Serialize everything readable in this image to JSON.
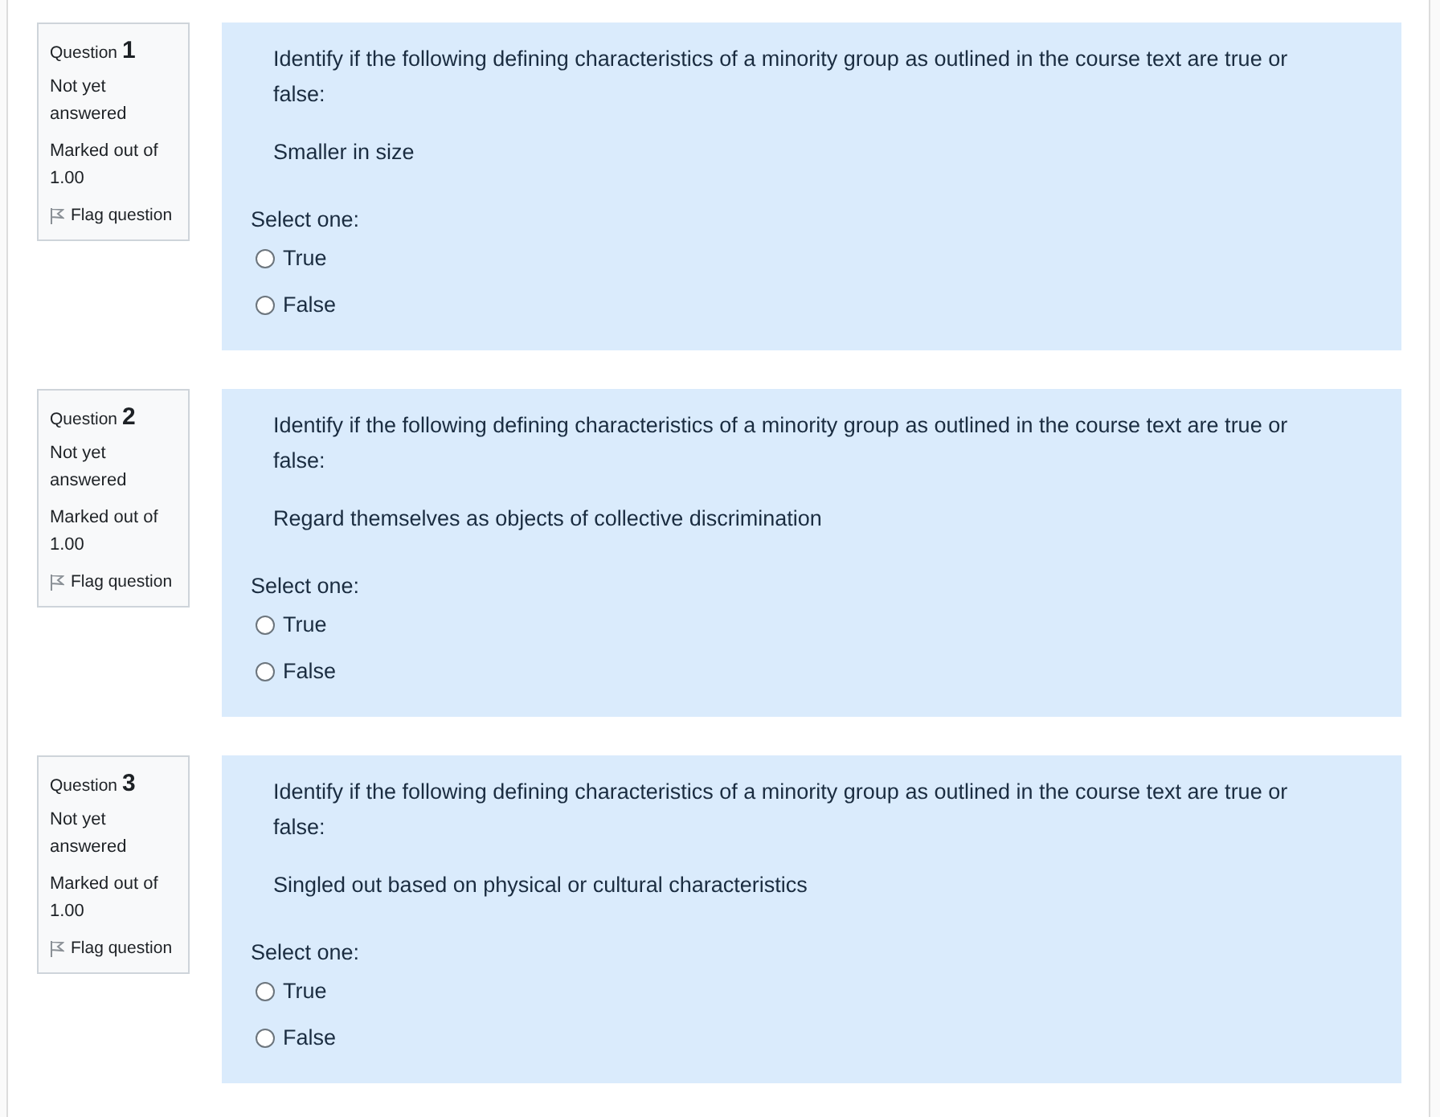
{
  "questions": [
    {
      "label": "Question",
      "number": "1",
      "status": "Not yet answered",
      "mark": "Marked out of 1.00",
      "flag": {
        "label": "Flag question",
        "flagged": false
      },
      "text": "Identify if the following defining characteristics of a minority group as outlined in the course text are true or false:",
      "statement": "Smaller in size",
      "prompt": "Select one:",
      "options": [
        {
          "label": "True",
          "selected": false
        },
        {
          "label": "False",
          "selected": false
        }
      ]
    },
    {
      "label": "Question",
      "number": "2",
      "status": "Not yet answered",
      "mark": "Marked out of 1.00",
      "flag": {
        "label": "Flag question",
        "flagged": false
      },
      "text": "Identify if the following defining characteristics of a minority group as outlined in the course text are true or false:",
      "statement": "Regard themselves as objects of collective discrimination",
      "prompt": "Select one:",
      "options": [
        {
          "label": "True",
          "selected": false
        },
        {
          "label": "False",
          "selected": false
        }
      ]
    },
    {
      "label": "Question",
      "number": "3",
      "status": "Not yet answered",
      "mark": "Marked out of 1.00",
      "flag": {
        "label": "Flag question",
        "flagged": false
      },
      "text": "Identify if the following defining characteristics of a minority group as outlined in the course text are true or false:",
      "statement": "Singled out based on physical or cultural characteristics",
      "prompt": "Select one:",
      "options": [
        {
          "label": "True",
          "selected": false
        },
        {
          "label": "False",
          "selected": false
        }
      ]
    }
  ]
}
